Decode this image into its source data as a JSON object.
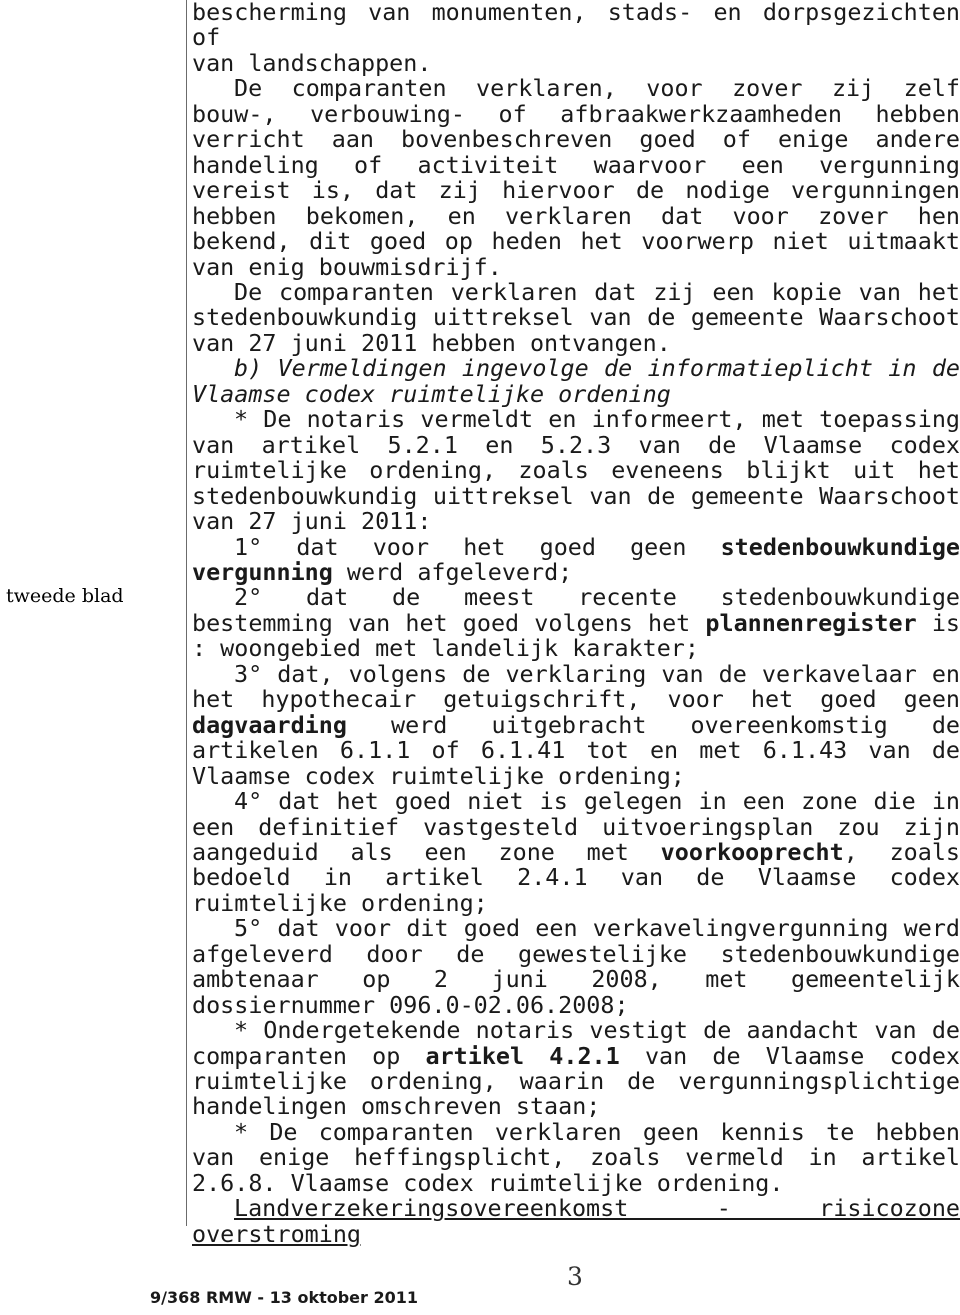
{
  "document": {
    "margin_note": "tweede blad",
    "page_number": "3",
    "footer_reference": "9/368 RMW - 13 oktober 2011",
    "paragraphs": {
      "p1_line1": "bescherming van monumenten, stads- en dorpsgezichten of",
      "p1_line2": "van landschappen.",
      "p2": "De comparanten verklaren, voor zover zij zelf bouw-, verbouwing- of afbraakwerkzaamheden hebben verricht aan bovenbeschreven goed of enige andere handeling of activiteit waarvoor een vergunning vereist is, dat zij hiervoor de nodige vergunningen hebben bekomen, en verklaren dat voor zover hen bekend, dit goed op heden het voorwerp niet uitmaakt van enig bouwmisdrijf.",
      "p3": "De comparanten verklaren dat zij een kopie van het stedenbouwkundig uittreksel van de gemeente Waarschoot van 27 juni 2011 hebben ontvangen.",
      "p4_heading": "b) Vermeldingen ingevolge de informatieplicht in de Vlaamse codex ruimtelijke ordening",
      "p5": "* De notaris vermeldt en informeert, met toepassing van artikel 5.2.1 en 5.2.3 van de Vlaamse codex ruimtelijke ordening, zoals eveneens blijkt uit het stedenbouwkundig uittreksel van de gemeente Waarschoot van 27 juni 2011:",
      "item1_pre": "1° dat voor het goed geen ",
      "item1_bold": "stedenbouwkundige vergunning",
      "item1_post": " werd afgeleverd;",
      "item2_pre": "2° dat de meest recente stedenbouwkundige bestemming van het goed volgens het ",
      "item2_bold": "plannenregister",
      "item2_post": " is : woongebied met landelijk karakter;",
      "item3_pre": "3° dat, volgens de verklaring van de verkavelaar en het hypothecair getuigschrift, voor het goed geen ",
      "item3_bold": "dagvaarding",
      "item3_post": " werd uitgebracht overeenkomstig de artikelen 6.1.1 of 6.1.41 tot en met 6.1.43 van de Vlaamse codex ruimtelijke ordening;",
      "item4_pre": "4° dat het goed niet is gelegen in een zone die in een definitief vastgesteld uitvoeringsplan zou zijn aangeduid als een zone met ",
      "item4_bold": "voorkooprecht",
      "item4_post": ", zoals bedoeld in artikel 2.4.1 van de Vlaamse codex ruimtelijke ordening;",
      "item5": "5° dat voor dit goed een verkavelingvergunning werd afgeleverd door de gewestelijke stedenbouwkundige ambtenaar op 2 juni 2008, met gemeentelijk dossiernummer 096.0-02.06.2008;",
      "p6_pre": "* Ondergetekende notaris vestigt de aandacht van de comparanten op ",
      "p6_bold": "artikel 4.2.1",
      "p6_post": " van de Vlaamse codex ruimtelijke ordening, waarin de vergunningsplichtige handelingen omschreven staan;",
      "p7": "* De comparanten verklaren geen kennis te hebben van enige heffingsplicht, zoals vermeld in artikel 2.6.8. Vlaamse codex ruimtelijke ordening.",
      "p8_underlined": "Landverzekeringsovereenkomst - risicozone overstroming"
    }
  }
}
